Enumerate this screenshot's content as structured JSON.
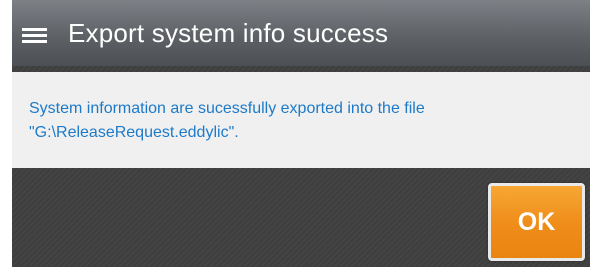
{
  "dialog": {
    "title": "Export system info success",
    "menu_icon": "hamburger-menu-icon",
    "message_line1": "System information are sucessfully exported into the file",
    "message_line2": "\"G:\\ReleaseRequest.eddylic\".",
    "ok_label": "OK"
  },
  "colors": {
    "title_bar": "#5e6166",
    "message_text": "#1d7ac9",
    "ok_button": "#f08e1b",
    "background": "#3f3f3f"
  }
}
